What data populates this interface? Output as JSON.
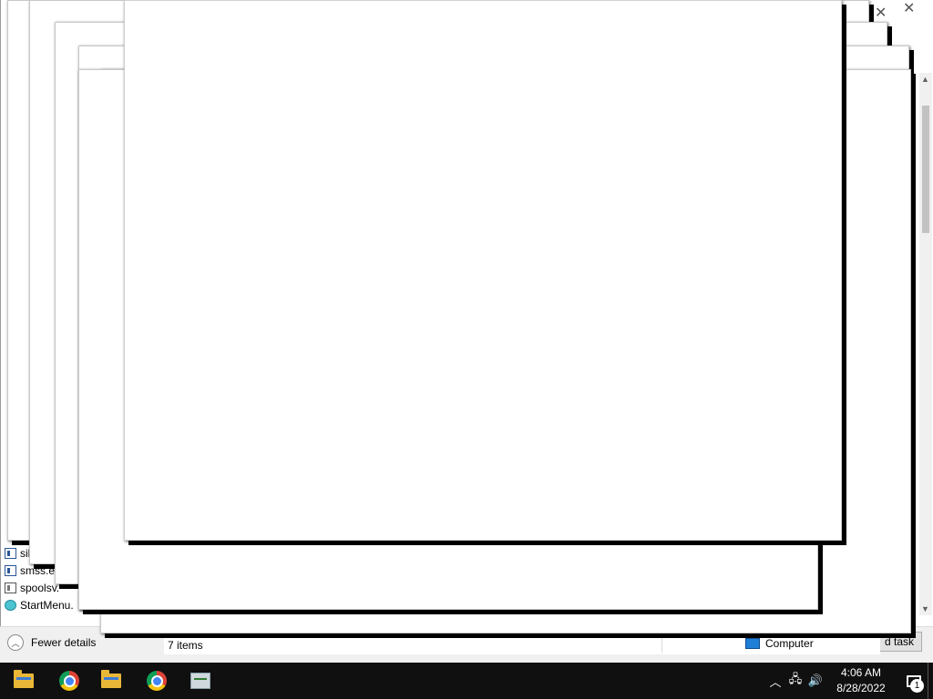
{
  "task_manager": {
    "processes": [
      {
        "name": "sil",
        "icon": "window-icon"
      },
      {
        "name": "smss.e",
        "icon": "window-icon"
      },
      {
        "name": "spoolsv.",
        "icon": "printer-icon"
      },
      {
        "name": "StartMenu.",
        "icon": "globe-icon"
      }
    ],
    "fewer_details_label": "Fewer details",
    "end_task_label": "d task"
  },
  "explorer": {
    "status_items": "7 items",
    "location_label": "Computer"
  },
  "taskbar": {
    "items": [
      {
        "name": "file-explorer",
        "icon": "folder-icon"
      },
      {
        "name": "chrome",
        "icon": "chrome-icon"
      },
      {
        "name": "file-explorer-2",
        "icon": "folder-icon"
      },
      {
        "name": "chrome-2",
        "icon": "chrome-icon"
      },
      {
        "name": "task-manager",
        "icon": "task-manager-icon"
      }
    ],
    "clock_time": "4:06 AM",
    "clock_date": "8/28/2022",
    "notification_count": "1",
    "tray_icons": [
      "chevron-up-icon",
      "network-icon",
      "volume-icon"
    ]
  },
  "colors": {
    "taskbar_bg": "#101010",
    "folder": "#e8b738",
    "accent_blue": "#1f7fd6"
  }
}
